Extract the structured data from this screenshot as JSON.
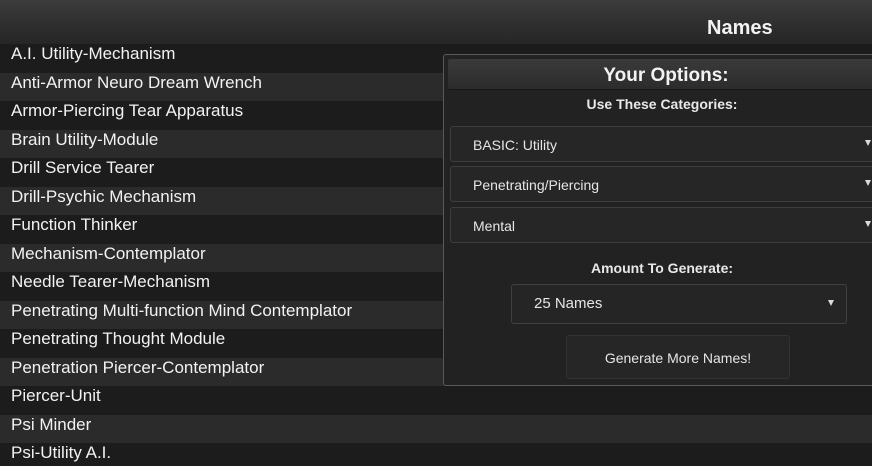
{
  "header": {
    "title": "Names"
  },
  "names": [
    "A.I. Utility-Mechanism",
    "Anti-Armor Neuro Dream Wrench",
    "Armor-Piercing Tear Apparatus",
    "Brain Utility-Module",
    "Drill Service Tearer",
    "Drill-Psychic Mechanism",
    "Function Thinker",
    "Mechanism-Contemplator",
    "Needle Tearer-Mechanism",
    "Penetrating Multi-function Mind Contemplator",
    "Penetrating Thought Module",
    "Penetration Piercer-Contemplator",
    "Piercer-Unit",
    "Psi Minder",
    "Psi-Utility A.I."
  ],
  "options": {
    "title": "Your Options:",
    "categories_label": "Use These Categories:",
    "category_1": "BASIC: Utility",
    "category_2": "Penetrating/Piercing",
    "category_3": "Mental",
    "amount_label": "Amount To Generate:",
    "amount_value": "25 Names",
    "generate_label": "Generate More Names!"
  },
  "colors": {
    "background": "#212121",
    "row_dark": "#1c1c1c",
    "row_light": "#2b2b2b",
    "text": "#f2f2f2",
    "panel_border": "#5a5a5a"
  }
}
